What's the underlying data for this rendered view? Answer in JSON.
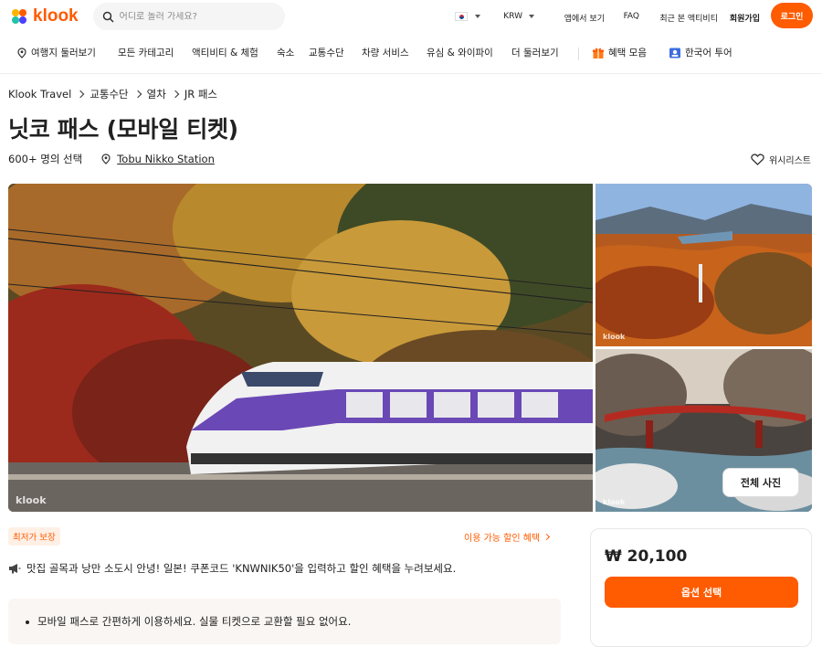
{
  "brand": {
    "logo_text": "klook"
  },
  "search": {
    "placeholder": "어디로 놀러 가세요?"
  },
  "topnav": {
    "currency": "KRW",
    "app": "앱에서 보기",
    "faq": "FAQ",
    "recent": "최근 본 액티비티",
    "signup": "회원가입",
    "login": "로그인"
  },
  "categories": [
    "여행지 둘러보기",
    "모든 카테고리",
    "액티비티 & 체험",
    "숙소",
    "교통수단",
    "차량 서비스",
    "유심 & 와이파이",
    "더 둘러보기",
    "혜택 모음",
    "한국어 투어"
  ],
  "breadcrumb": [
    "Klook Travel",
    "교통수단",
    "열차",
    "JR 패스"
  ],
  "product": {
    "title": "닛코 패스 (모바일 티켓)",
    "booked": "600+ 명의 선택",
    "location": "Tobu Nikko Station",
    "wishlist": "위시리스트",
    "all_photos": "전체 사진",
    "watermark": "klook"
  },
  "offers": {
    "badge": "최저가 보장",
    "discount_link": "이용 가능 할인 혜택",
    "promo_text": "맛집 골목과 낭만 소도시 안녕! 일본! 쿠폰코드 'KNWNIK50'을 입력하고 할인 혜택을 누려보세요.",
    "feature": "모바일 패스로 간편하게 이용하세요. 실물 티켓으로 교환할 필요 없어요."
  },
  "booking": {
    "price": "₩ 20,100",
    "button": "옵션 선택"
  },
  "colors": {
    "brand": "#ff5b00"
  }
}
